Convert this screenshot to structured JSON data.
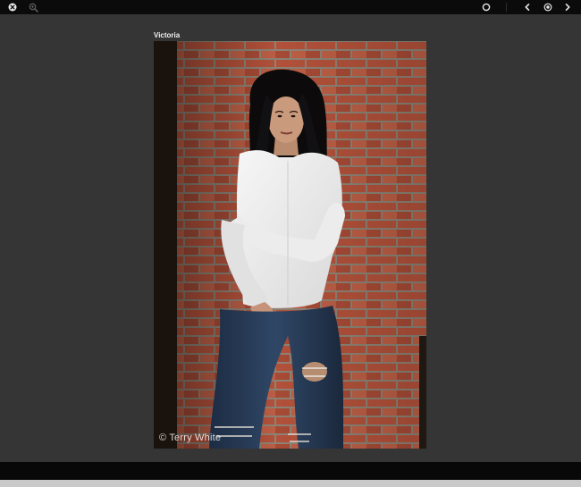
{
  "viewer": {
    "toolbar": {
      "left_icons": [
        "close-icon",
        "zoom-icon"
      ],
      "right_icons": [
        "slideshow-icon",
        "previous-icon",
        "play-icon",
        "next-icon"
      ]
    },
    "photo": {
      "caption": "Victoria",
      "watermark": "© Terry White",
      "subject": "portrait"
    },
    "colors": {
      "toolbar_bg": "#0b0b0b",
      "stage_bg": "#353535",
      "caption_text": "#f2f2f2",
      "icon": "#e8e8e8",
      "icon_dim": "#5a5a5a"
    }
  }
}
